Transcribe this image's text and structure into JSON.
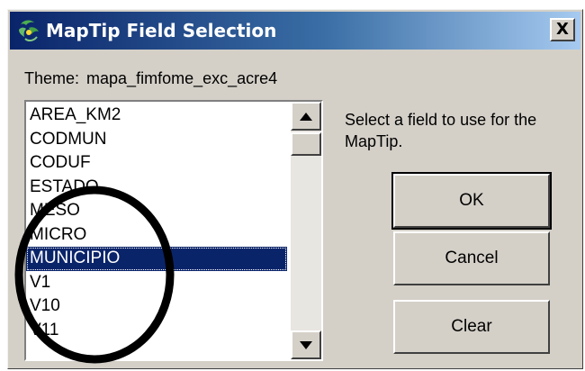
{
  "window": {
    "title": "MapTip Field Selection",
    "title_icon": "globe-app-icon",
    "close_icon": "close-icon",
    "close_label": "X"
  },
  "theme": {
    "label": "Theme:",
    "value": "mapa_fimfome_exc_acre4"
  },
  "field_list": {
    "items": [
      "AREA_KM2",
      "CODMUN",
      "CODUF",
      "ESTADO",
      "MESO",
      "MICRO",
      "MUNICIPIO",
      "V1",
      "V10",
      "V11"
    ],
    "selected": "MUNICIPIO"
  },
  "hint": "Select a field to use for the MapTip.",
  "buttons": {
    "ok": "OK",
    "cancel": "Cancel",
    "clear": "Clear"
  },
  "colors": {
    "title_bar": "#0a246a",
    "selection": "#0a246a",
    "dialog_face": "#d4d0c8",
    "annotation": "#000000"
  }
}
